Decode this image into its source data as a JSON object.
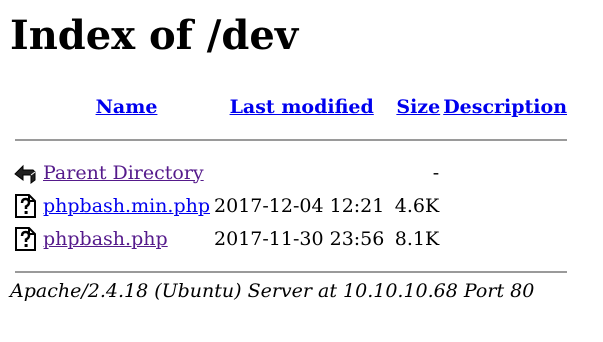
{
  "heading": "Index of /dev",
  "columns": {
    "name": "Name",
    "last_modified": "Last modified",
    "size": "Size",
    "description": "Description"
  },
  "entries": [
    {
      "icon": "back-icon",
      "name": "Parent Directory",
      "last_modified": "",
      "size": "-",
      "description": "",
      "visited": true
    },
    {
      "icon": "unknown-file-icon",
      "name": "phpbash.min.php",
      "last_modified": "2017-12-04 12:21",
      "size": "4.6K",
      "description": "",
      "visited": false
    },
    {
      "icon": "unknown-file-icon",
      "name": "phpbash.php",
      "last_modified": "2017-11-30 23:56",
      "size": "8.1K",
      "description": "",
      "visited": true
    }
  ],
  "footer": "Apache/2.4.18 (Ubuntu) Server at 10.10.10.68 Port 80",
  "colors": {
    "link": "#0000ee",
    "visited": "#551a8b",
    "rule": "#9a9a9a"
  }
}
